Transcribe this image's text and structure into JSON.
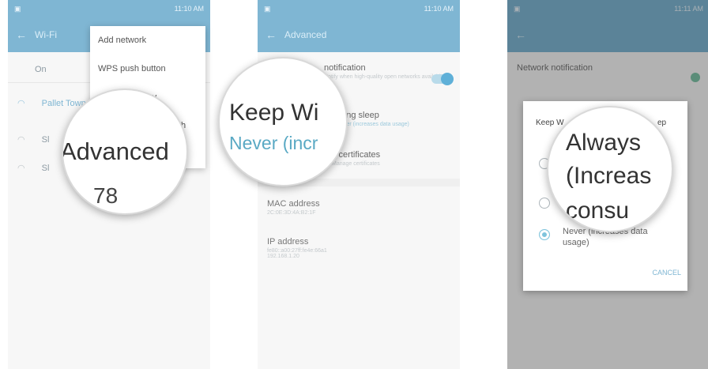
{
  "panel1": {
    "status_time": "11:10 AM",
    "title": "Wi-Fi",
    "toggle_label": "On",
    "networks": [
      "Pallet Town",
      "Sl",
      "Sl"
    ],
    "menu_items": [
      "Add network",
      "WPS push button",
      "try",
      "itch"
    ],
    "magnifier_text": "Advanced",
    "magnifier_bottom": "78"
  },
  "panel2": {
    "status_time": "11:10 AM",
    "title": "Advanced",
    "items": [
      {
        "label": "notification",
        "sub": "Notify when high-quality open networks available"
      },
      {
        "label": "uring sleep",
        "sub": "Never (increases data usage)"
      },
      {
        "label": "k certificates",
        "sub": "Manage certificates"
      },
      {
        "label": "MAC address",
        "sub": "2C:0E:3D:4A:B2:1F"
      },
      {
        "label": "IP address",
        "sub": "fe80::a00:27ff:fe4e:66a1 192.168.1.20"
      }
    ],
    "magnifier_line1": "Keep Wi",
    "magnifier_line2": "Never (incr"
  },
  "panel3": {
    "status_time": "11:11 AM",
    "bg_title": "Network notification",
    "dialog_title_left": "Keep W",
    "dialog_title_right": "ep",
    "options": [
      "Always",
      "Only when plugged in",
      "Never (increases data usage)"
    ],
    "cancel_label": "CANCEL",
    "magnifier_line1": "Always",
    "magnifier_line2": "(Increas",
    "magnifier_line3": "consu"
  }
}
